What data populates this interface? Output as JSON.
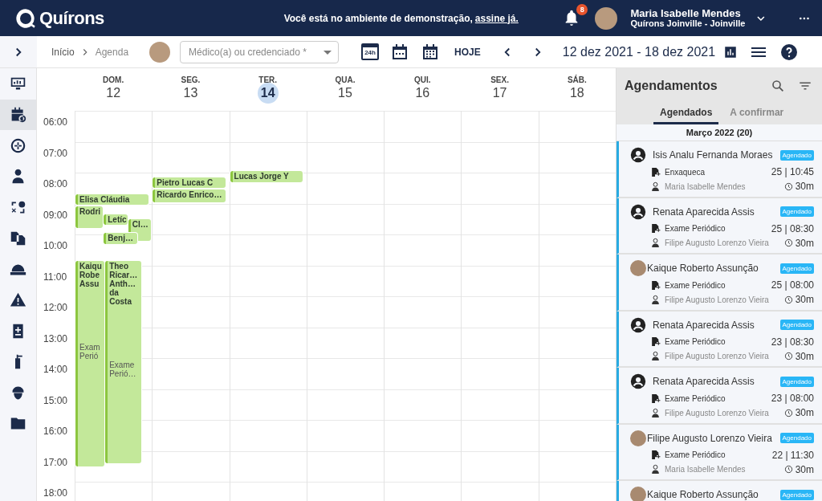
{
  "header": {
    "logo": "Quírons",
    "notice": "Você está no ambiente de demonstração,",
    "notice_link": "assine já.",
    "notifications": "8",
    "user_name": "Maria Isabelle Mendes",
    "user_unit": "Quírons Joinville - Joinville"
  },
  "sidebar": {
    "items": [
      {
        "selected": false
      },
      {
        "selected": true
      },
      {
        "selected": false
      },
      {
        "selected": false
      },
      {
        "selected": false
      },
      {
        "selected": false
      },
      {
        "selected": false
      },
      {
        "selected": false
      },
      {
        "selected": false
      },
      {
        "selected": false
      },
      {
        "selected": false
      },
      {
        "selected": false
      }
    ]
  },
  "toolbar": {
    "breadcrumbs": [
      "Início",
      "Agenda"
    ],
    "professional_select": {
      "placeholder": "Médico(a) ou credenciado *"
    },
    "day_view_label": "24h",
    "today": "HOJE",
    "range": "12 dez 2021 - 18 dez 2021"
  },
  "calendar": {
    "days": [
      {
        "weekday": "DOM.",
        "date": "12",
        "selected": false,
        "events": [
          {
            "title": "Elisa Cláudia"
          },
          {
            "title": "Rodri"
          },
          {
            "title": "Letíc"
          },
          {
            "title": "Cl…"
          },
          {
            "title": "Benj…"
          },
          {
            "title": "Kaiqu Robe Assu",
            "detail": "Exam Perió"
          },
          {
            "title": "Theo Ricar… Anth… da Costa",
            "detail": "Exame Perió…"
          }
        ]
      },
      {
        "weekday": "SEG.",
        "date": "13",
        "selected": false,
        "events": [
          {
            "title": "Pietro Lucas C"
          },
          {
            "title": "Ricardo Enrico…"
          }
        ]
      },
      {
        "weekday": "TER.",
        "date": "14",
        "selected": true,
        "events": [
          {
            "title": "Lucas Jorge Y"
          }
        ]
      },
      {
        "weekday": "QUA.",
        "date": "15",
        "selected": false
      },
      {
        "weekday": "QUI.",
        "date": "16",
        "selected": false
      },
      {
        "weekday": "SEX.",
        "date": "17",
        "selected": false
      },
      {
        "weekday": "SÁB.",
        "date": "18",
        "selected": false
      }
    ],
    "hours": [
      "06:00",
      "07:00",
      "08:00",
      "09:00",
      "10:00",
      "11:00",
      "12:00",
      "13:00",
      "14:00",
      "15:00",
      "16:00",
      "17:00",
      "18:00"
    ]
  },
  "panel": {
    "title": "Agendamentos",
    "tabs": [
      {
        "label": "Agendados",
        "selected": true
      },
      {
        "label": "A confirmar",
        "selected": false
      }
    ],
    "group": "Março 2022 (20)",
    "appointments": [
      {
        "kind": "icon",
        "patient": "Isis Analu Fernanda Moraes",
        "status": "Agendado",
        "reason": "Enxaqueca",
        "date": "25 | 10:45",
        "professional": "Maria Isabelle Mendes",
        "duration": "30m"
      },
      {
        "kind": "icon",
        "patient": "Renata Aparecida Assis",
        "status": "Agendado",
        "reason": "Exame Periódico",
        "date": "25 | 08:30",
        "professional": "Filipe Augusto Lorenzo Vieira",
        "duration": "30m"
      },
      {
        "kind": "photo",
        "patient": "Kaique Roberto Assunção",
        "status": "Agendado",
        "reason": "Exame Periódico",
        "date": "25 | 08:00",
        "professional": "Filipe Augusto Lorenzo Vieira",
        "duration": "30m"
      },
      {
        "kind": "icon",
        "patient": "Renata Aparecida Assis",
        "status": "Agendado",
        "reason": "Exame Periódico",
        "date": "23 | 08:30",
        "professional": "Filipe Augusto Lorenzo Vieira",
        "duration": "30m"
      },
      {
        "kind": "icon",
        "patient": "Renata Aparecida Assis",
        "status": "Agendado",
        "reason": "Exame Periódico",
        "date": "23 | 08:00",
        "professional": "Filipe Augusto Lorenzo Vieira",
        "duration": "30m"
      },
      {
        "kind": "photo",
        "patient": "Filipe Augusto Lorenzo Vieira",
        "status": "Agendado",
        "reason": "Exame Periódico",
        "date": "22 | 11:30",
        "professional": "Maria Isabelle Mendes",
        "duration": "30m"
      },
      {
        "kind": "photo",
        "patient": "Kaique Roberto Assunção",
        "status": "Agendado"
      }
    ]
  }
}
